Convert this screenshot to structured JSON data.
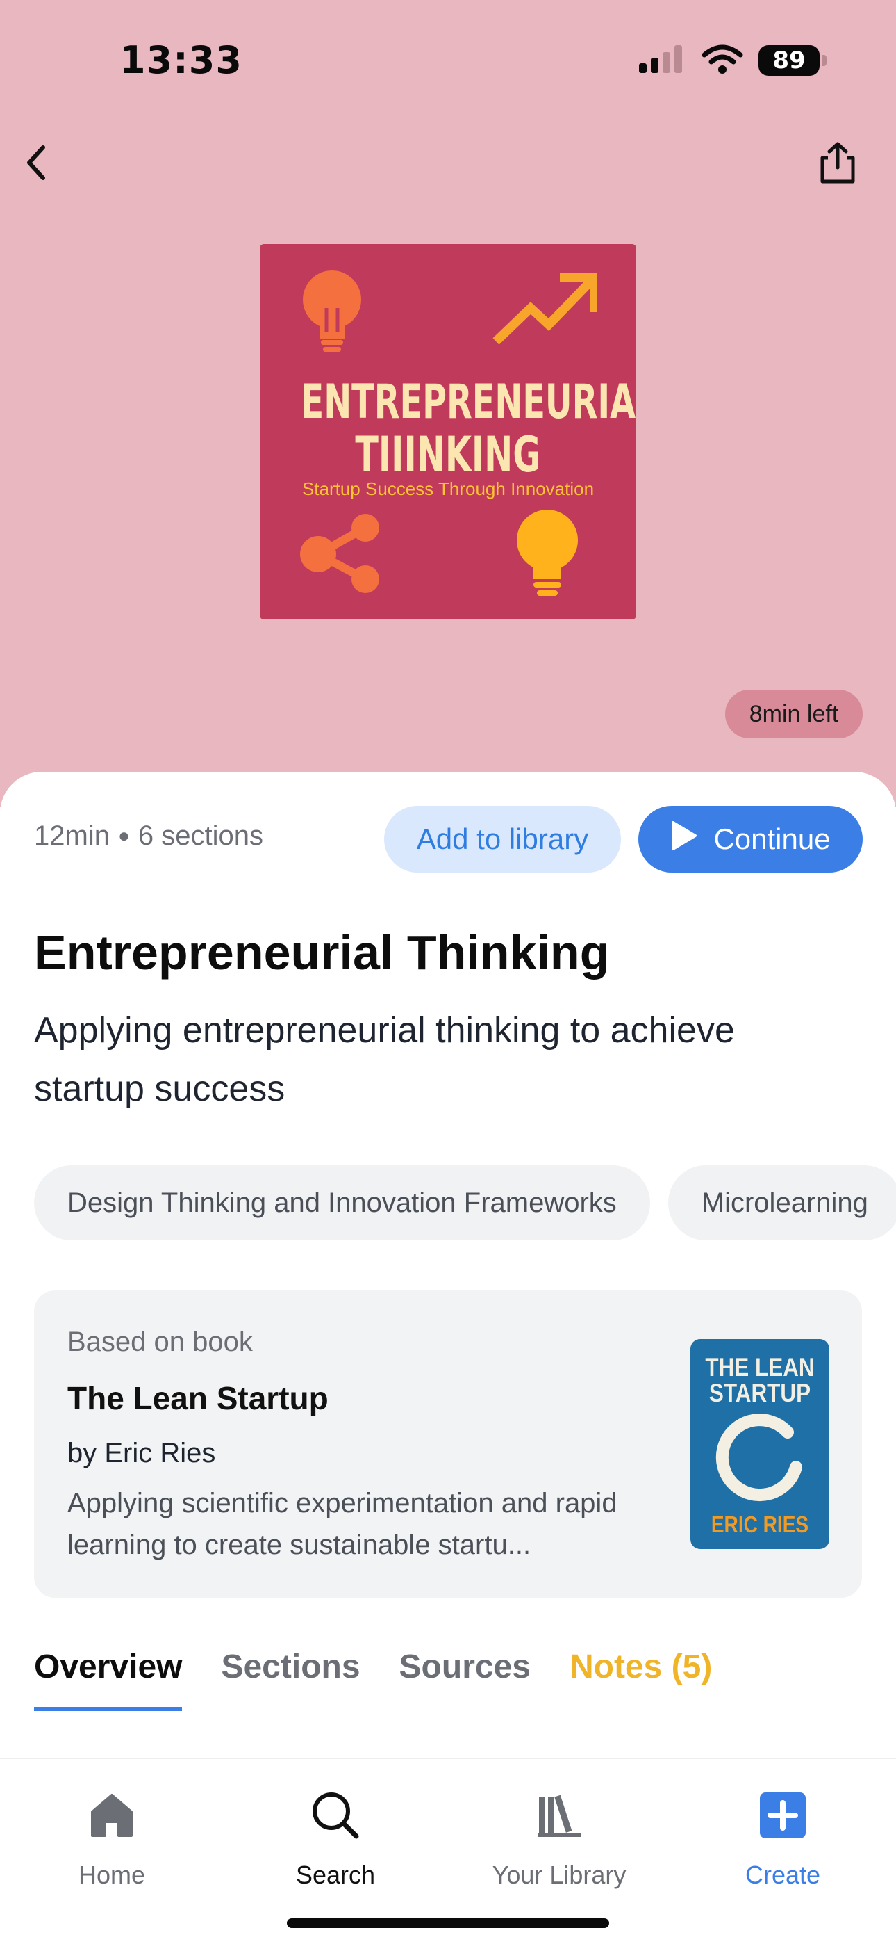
{
  "status_bar": {
    "time": "13:33",
    "battery": "89"
  },
  "hero": {
    "cover": {
      "title_line1": "ENTREPRENEURIAL",
      "title_line2": "TIIINKING",
      "subtitle": "Startup Success Through Innovation"
    },
    "time_left": "8min left"
  },
  "summary": {
    "duration": "12min",
    "sections": "6 sections",
    "add_label": "Add to library",
    "continue_label": "Continue"
  },
  "title": "Entrepreneurial Thinking",
  "subtitle": "Applying entrepreneurial thinking to achieve startup success",
  "chips": [
    "Design Thinking and Innovation Frameworks",
    "Microlearning"
  ],
  "book": {
    "label": "Based on book",
    "title": "The Lean Startup",
    "author": "by Eric Ries",
    "description": "Applying scientific experimentation and rapid learning to create sustainable startu...",
    "cover_title": "THE LEAN STARTUP",
    "cover_author": "ERIC RIES"
  },
  "tabs": [
    "Overview",
    "Sections",
    "Sources",
    "Notes (5)"
  ],
  "bottom_nav": [
    "Home",
    "Search",
    "Your Library",
    "Create"
  ],
  "colors": {
    "accent": "#3b7fe6",
    "hero_bg": "#e8b7bf",
    "cover_bg": "#bf3a5b",
    "notes": "#f0b429"
  }
}
